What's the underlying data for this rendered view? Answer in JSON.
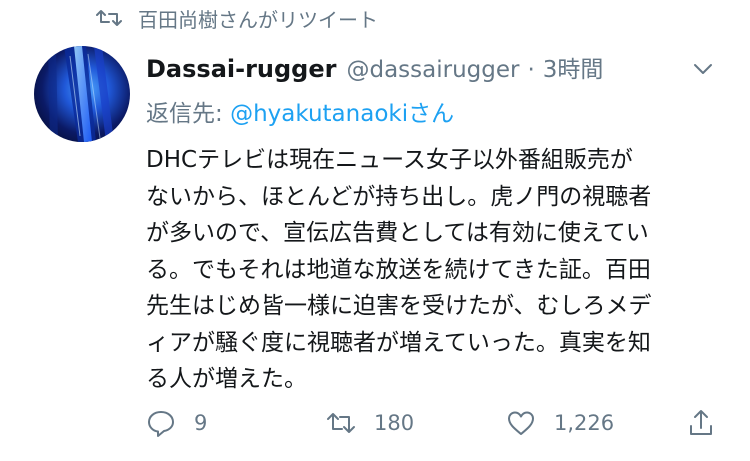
{
  "retweet_context": {
    "text": "百田尚樹さんがリツイート",
    "icon": "retweet-icon"
  },
  "tweet": {
    "display_name": "Dassai-rugger",
    "handle": "@dassairugger",
    "separator": "·",
    "time": "3時間",
    "reply_label": "返信先: ",
    "reply_mention": "@hyakutanaoki",
    "reply_suffix": "さん",
    "text_lines": [
      "DHCテレビは現在ニュース女子以外番組販売が",
      "ないから、ほとんどが持ち出し。虎ノ門の視聴者",
      "が多いので、宣伝広告費としては有効に使えてい",
      "る。でもそれは地道な放送を続けてきた証。百田",
      "先生はじめ皆一様に迫害を受けたが、むしろメデ",
      "ィアが騒ぐ度に視聴者が増えていった。真実を知",
      "る人が増えた。"
    ]
  },
  "actions": {
    "reply": {
      "icon": "reply-icon",
      "count": "9"
    },
    "retweet": {
      "icon": "retweet-icon",
      "count": "180"
    },
    "like": {
      "icon": "heart-icon",
      "count": "1,226"
    },
    "share": {
      "icon": "share-icon"
    }
  },
  "colors": {
    "text": "#14171a",
    "secondary": "#657786",
    "link": "#1da1f2",
    "background": "#ffffff"
  }
}
